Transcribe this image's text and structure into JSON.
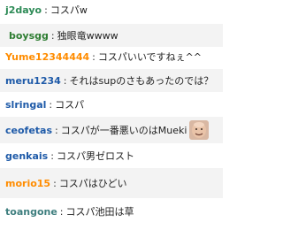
{
  "separator": ":",
  "messages": [
    {
      "user": "j2dayo",
      "text": "コスパw",
      "color": "#2e8b57"
    },
    {
      "user": "boysgg",
      "text": "独眼竜wwww",
      "color": "#2e7d32"
    },
    {
      "user": "Yume12344444",
      "text": "コスパいいですねぇ^^",
      "color": "#ff8c00"
    },
    {
      "user": "meru1234",
      "text": "それはsupのさもあったのでは？",
      "color": "#1e5aa8"
    },
    {
      "user": "slringal",
      "text": "コスパ",
      "color": "#1e5aa8"
    },
    {
      "user": "ceofetas",
      "text": "コスパが一番悪いのはMueki",
      "color": "#1e5aa8",
      "emote": "bald-face-emote"
    },
    {
      "user": "genkais",
      "text": "コスパ男ゼロスト",
      "color": "#1e5aa8"
    },
    {
      "user": "morio15",
      "text": "コスパはひどい",
      "color": "#ff8c00"
    },
    {
      "user": "toangone",
      "text": "コスパ池田は草",
      "color": "#3f7f7f"
    }
  ]
}
